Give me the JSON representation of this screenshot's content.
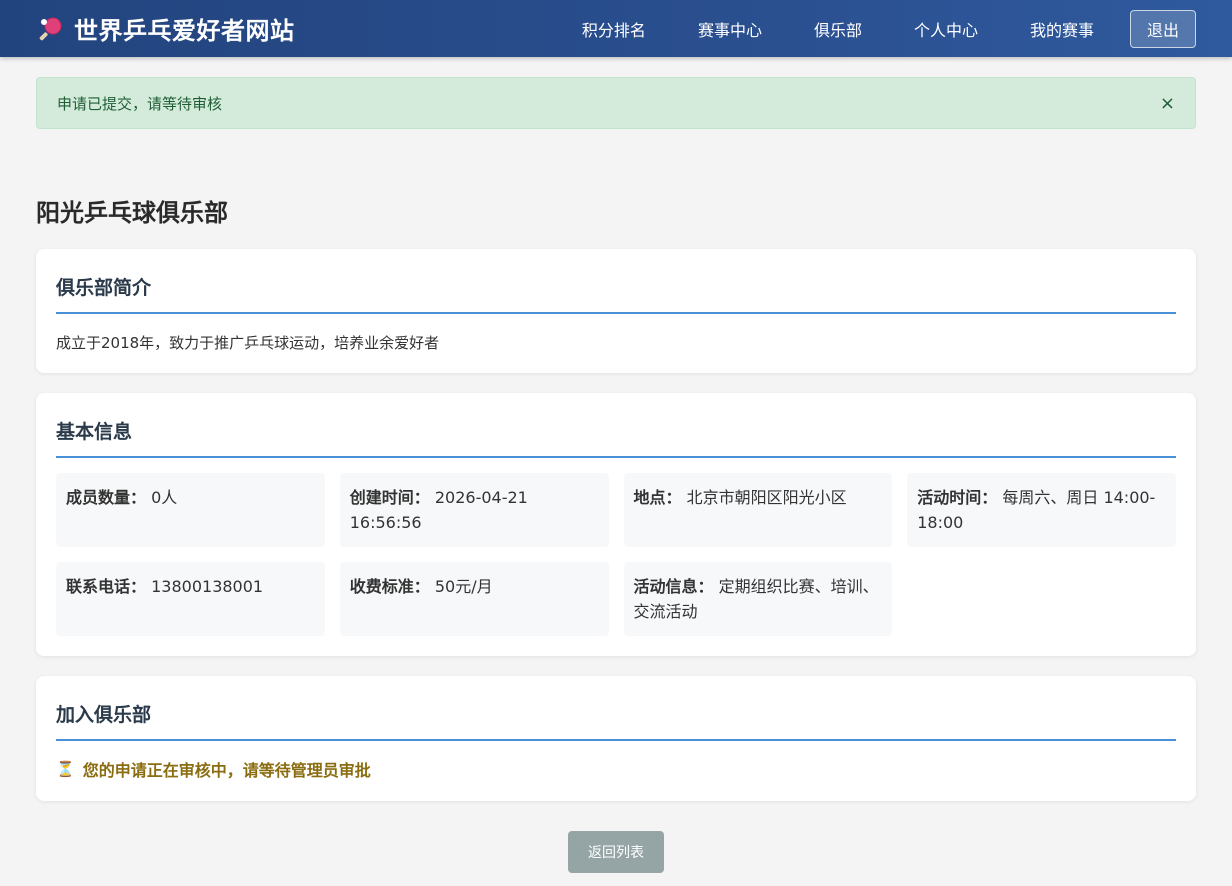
{
  "header": {
    "brand_icon": "ping-pong-paddle-icon",
    "brand": "世界乒乓爱好者网站",
    "nav": [
      "积分排名",
      "赛事中心",
      "俱乐部",
      "个人中心",
      "我的赛事"
    ],
    "logout": "退出"
  },
  "alert": {
    "message": "申请已提交，请等待审核",
    "close": "×"
  },
  "club": {
    "name": "阳光乒乓球俱乐部",
    "intro": {
      "title": "俱乐部简介",
      "text": "成立于2018年，致力于推广乒乓球运动，培养业余爱好者"
    },
    "basic": {
      "title": "基本信息",
      "items": [
        {
          "label": "成员数量：",
          "value": "0人"
        },
        {
          "label": "创建时间：",
          "value": "2026-04-21 16:56:56"
        },
        {
          "label": "地点：",
          "value": "北京市朝阳区阳光小区"
        },
        {
          "label": "活动时间：",
          "value": "每周六、周日 14:00-18:00"
        },
        {
          "label": "联系电话：",
          "value": "13800138001"
        },
        {
          "label": "收费标准：",
          "value": "50元/月"
        },
        {
          "label": "活动信息：",
          "value": "定期组织比赛、培训、交流活动"
        }
      ]
    },
    "join": {
      "title": "加入俱乐部",
      "icon": "hourglass-icon",
      "status": "您的申请正在审核中，请等待管理员审批"
    }
  },
  "footer": {
    "back": "返回列表"
  },
  "colors": {
    "nav_bg": "#2a4f8f",
    "accent_line": "#4a90d9",
    "alert_bg": "#d4ebdb",
    "pending_text": "#8a6d10",
    "back_btn": "#95a5a6"
  }
}
